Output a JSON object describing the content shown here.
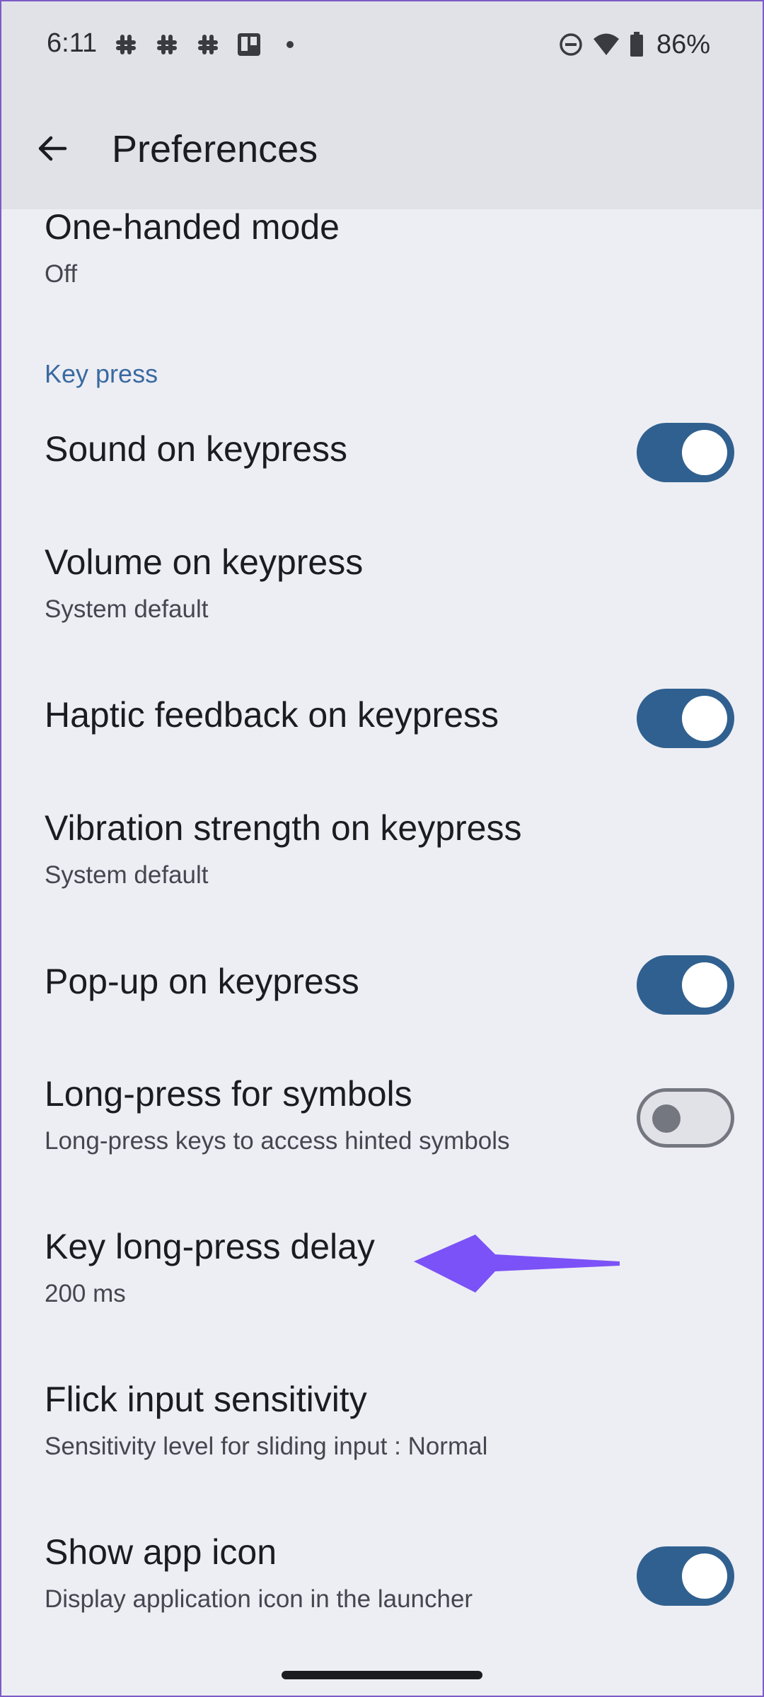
{
  "status_bar": {
    "time": "6:11",
    "battery": "86%",
    "notification_icons": [
      "slack-icon",
      "slack-icon",
      "slack-icon",
      "trello-icon",
      "dot-icon"
    ],
    "system_icons": [
      "do-not-disturb-icon",
      "wifi-icon",
      "battery-icon"
    ]
  },
  "app_bar": {
    "title": "Preferences",
    "back_icon": "arrow-back-icon"
  },
  "settings": {
    "one_handed": {
      "title": "One-handed mode",
      "subtitle": "Off"
    },
    "section_key_press": "Key press",
    "sound": {
      "title": "Sound on keypress",
      "enabled": true
    },
    "volume": {
      "title": "Volume on keypress",
      "subtitle": "System default"
    },
    "haptic": {
      "title": "Haptic feedback on keypress",
      "enabled": true
    },
    "vibration": {
      "title": "Vibration strength on keypress",
      "subtitle": "System default"
    },
    "popup": {
      "title": "Pop-up on keypress",
      "enabled": true
    },
    "long_press_symbols": {
      "title": "Long-press for symbols",
      "subtitle": "Long-press keys to access hinted symbols",
      "enabled": false
    },
    "long_press_delay": {
      "title": "Key long-press delay",
      "subtitle": "200 ms"
    },
    "flick": {
      "title": "Flick input sensitivity",
      "subtitle": "Sensitivity level for sliding input : Normal"
    },
    "app_icon": {
      "title": "Show app icon",
      "subtitle": "Display application icon in the launcher",
      "enabled": true
    }
  },
  "colors": {
    "background": "#edeef4",
    "app_bar": "#e1e2e8",
    "toggle_on": "#30608f",
    "section_header": "#3a6aa0",
    "annotation_arrow": "#7b52f7"
  }
}
